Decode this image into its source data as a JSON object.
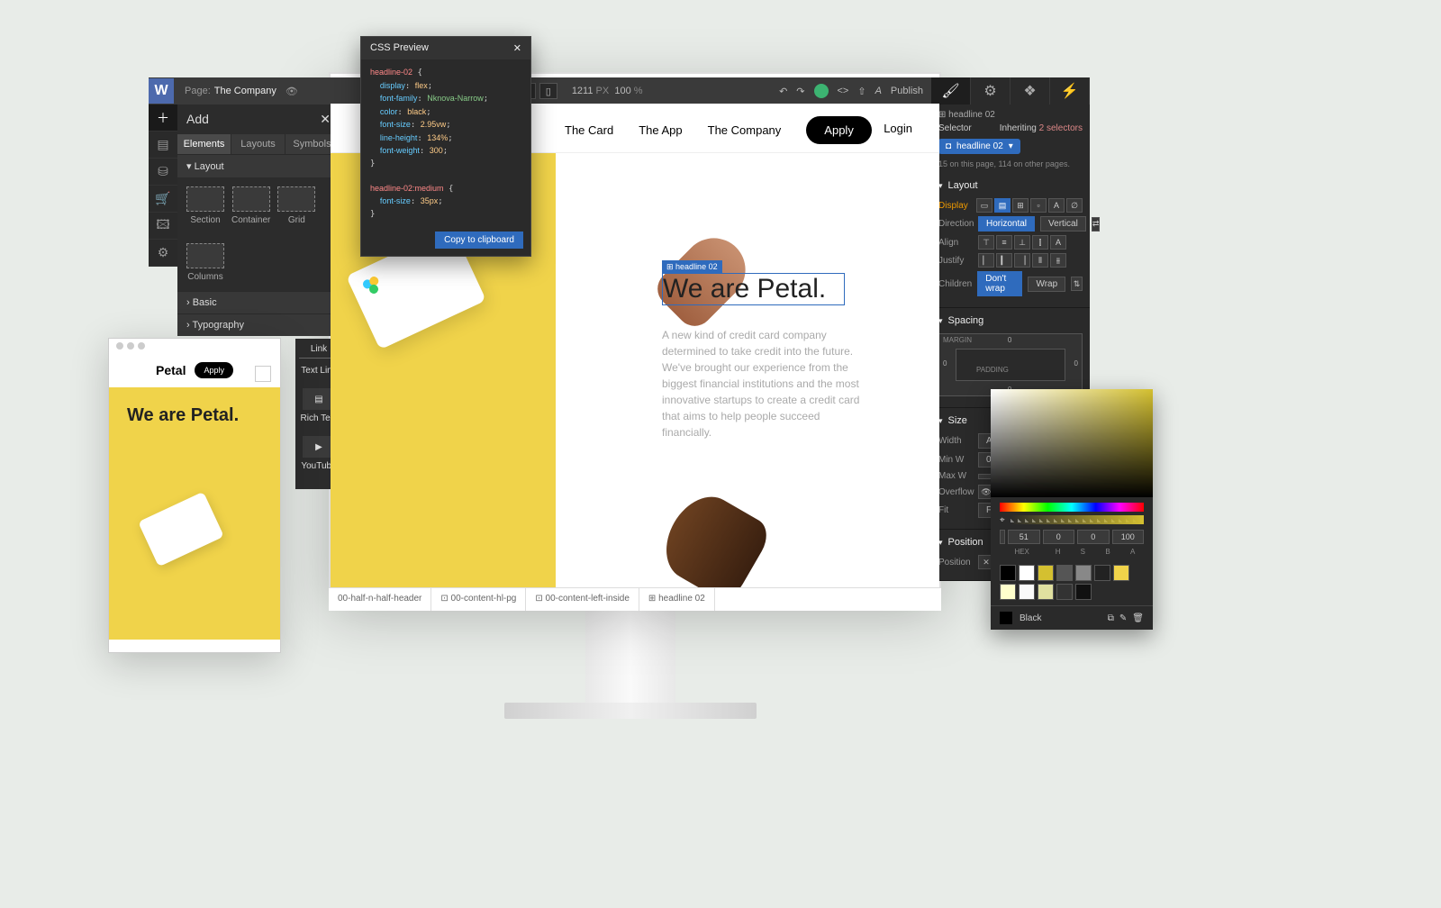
{
  "topbar": {
    "page_label": "Page:",
    "page_name": "The Company",
    "res_px": "1211",
    "res_unit": "PX",
    "zoom": "100",
    "zoom_unit": "%",
    "publish": "Publish"
  },
  "add_panel": {
    "title": "Add",
    "tabs": [
      "Elements",
      "Layouts",
      "Symbols"
    ],
    "cat_layout": "Layout",
    "items": [
      "Section",
      "Container",
      "Grid",
      "Columns"
    ],
    "cat_basic": "› Basic",
    "cat_typo": "› Typography"
  },
  "link_panel": {
    "title": "Link",
    "items": [
      "Text Link",
      "Rich Text",
      "YouTube"
    ]
  },
  "canvas": {
    "nav": [
      "The Card",
      "The App",
      "The Company"
    ],
    "apply": "Apply",
    "login": "Login",
    "headline_tag": "⊞ headline 02",
    "headline": "We are Petal.",
    "body": "A new kind of credit card company determined to take credit into the future. We've brought our experience from the biggest financial institutions and the most innovative startups to create a credit card that aims to help people succeed financially."
  },
  "breadcrumb": {
    "items": [
      "00-half-n-half-header",
      "⊡ 00-content-hl-pg",
      "⊡ 00-content-left-inside",
      "⊞ headline 02"
    ]
  },
  "css_popup": {
    "title": "CSS Preview",
    "class1": "headline-02",
    "props": [
      {
        "k": "display",
        "v": "flex"
      },
      {
        "k": "font-family",
        "v": "Nknova-Narrow"
      },
      {
        "k": "color",
        "v": "black"
      },
      {
        "k": "font-size",
        "v": "2.95vw"
      },
      {
        "k": "line-height",
        "v": "134%"
      },
      {
        "k": "font-weight",
        "v": "300"
      }
    ],
    "class2": "headline-02:medium",
    "props2": [
      {
        "k": "font-size",
        "v": "35px"
      }
    ],
    "copy": "Copy to clipboard"
  },
  "selector": {
    "crumb": "⊞ headline 02",
    "label": "Selector",
    "inherit_lbl": "Inheriting",
    "inherit_val": "2 selectors",
    "class": "headline 02",
    "note": "15 on this page, 114 on other pages."
  },
  "inspector": {
    "layout": {
      "title": "Layout",
      "display": "Display",
      "direction": "Direction",
      "dir_opts": [
        "Horizontal",
        "Vertical"
      ],
      "align": "Align",
      "justify": "Justify",
      "children": "Children",
      "child_opts": [
        "Don't wrap",
        "Wrap"
      ]
    },
    "spacing": {
      "title": "Spacing",
      "margin": "MARGIN",
      "padding": "PADDING",
      "vals": {
        "t": "0",
        "r": "0",
        "b": "0",
        "l": "0"
      }
    },
    "size": {
      "title": "Size",
      "width": "Width",
      "minw": "Min W",
      "maxw": "Max W",
      "overflow": "Overflow",
      "fit": "Fit",
      "auto": "Au",
      "zero": "0"
    },
    "position": {
      "title": "Position",
      "label": "Position"
    }
  },
  "picker": {
    "hex": "#000000",
    "hsba": [
      "51",
      "0",
      "0",
      "100"
    ],
    "labels": [
      "HEX",
      "H",
      "S",
      "B",
      "A"
    ],
    "name": "Black",
    "swatches": [
      "#000000",
      "#ffffff",
      "#d4c030",
      "#555555",
      "#888888",
      "#222222",
      "#f0d34a",
      "#ffffcc",
      "#fafafa",
      "#e0e0a0",
      "#333333",
      "#111111"
    ]
  },
  "mobile": {
    "brand": "Petal",
    "apply": "Apply",
    "headline": "We are Petal."
  }
}
